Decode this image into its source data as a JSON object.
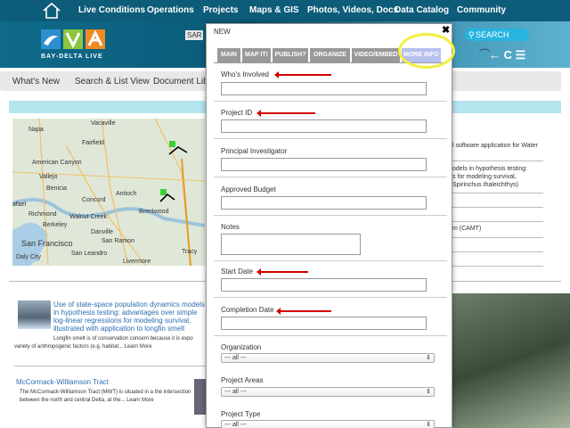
{
  "nav": {
    "items": [
      "Live Conditions",
      "Operations",
      "Projects",
      "Maps & GIS",
      "Photos, Videos, Docs",
      "Data Catalog",
      "Community"
    ]
  },
  "header": {
    "logo_text": "BAY-DELTA LIVE",
    "search_partial": "SAR",
    "search_label": "SEARCH",
    "icons_text": "← C ☰"
  },
  "submenu": {
    "items": [
      "What's New",
      "Search & List View",
      "Document Libra"
    ]
  },
  "map": {
    "labels": [
      "Vacaville",
      "Napa",
      "Fairfield",
      "American Canyon",
      "Vallejo",
      "Benicia",
      "Concord",
      "Antioch",
      "Brentwood",
      "Richmond",
      "Walnut Creek",
      "Berkeley",
      "Danville",
      "San Ramon",
      "San Francisco",
      "San Leandro",
      "Livermore",
      "Tracy",
      "Daly City",
      "afael"
    ]
  },
  "right_content": {
    "lines": [
      "l software application for Water",
      "odels in hypothesis testing:",
      "s for modeling survival,",
      "Spirinchus thaleichthys)",
      "m (CAMT)"
    ]
  },
  "article": {
    "title": "Use of state-space population dynamics models in hypothesis testing: advantages over simple log-linear regressions for modeling survival, illustrated with application to longfin smelt (Spirinchus thaleichthys)",
    "body_line1": "Longfin smelt is of conservation concern because it is expo",
    "body_line2": "variety of anthropogenic factors (e.g. habitat... Learn More"
  },
  "mccormack": {
    "title": "McCormack-Williamson Tract",
    "body": "The McCormack-Williamson Tract (MWT) is situated in a the intersection between the north and central Delta, at the... Learn More"
  },
  "modal": {
    "title": "NEW",
    "close": "✖",
    "tabs": [
      "MAIN",
      "MAP IT!",
      "PUBLISH?",
      "ORGANIZE",
      "VIDEO/EMBED",
      "MORE INFO"
    ],
    "fields": {
      "whos_involved": "Who's Involved",
      "project_id": "Project ID",
      "principal_investigator": "Principal Investigator",
      "approved_budget": "Approved Budget",
      "notes": "Notes",
      "start_date": "Start Date",
      "completion_date": "Completion Date",
      "organization": "Organization",
      "project_areas": "Project Areas",
      "project_type": "Project Type"
    },
    "select_all": "--- all ---"
  },
  "colors": {
    "nav_bg": "#0d5c7a",
    "search_btn": "#27b4e0",
    "active_tab": "#b8c0f0",
    "annotation_red": "#d40000",
    "highlight_yellow": "#f3ef3b"
  }
}
